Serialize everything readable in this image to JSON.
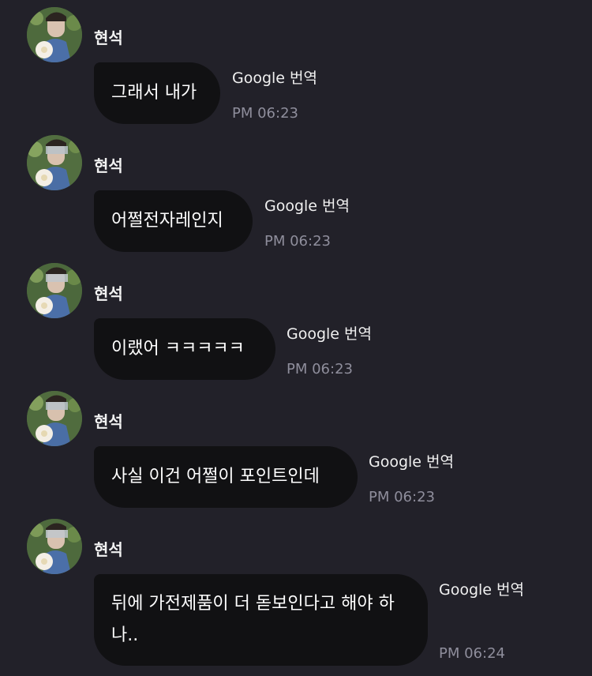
{
  "messages": [
    {
      "sender": "현석",
      "text": "그래서 내가",
      "translate": "Google 번역",
      "time": "PM 06:23"
    },
    {
      "sender": "현석",
      "text": "어쩔전자레인지",
      "translate": "Google 번역",
      "time": "PM 06:23"
    },
    {
      "sender": "현석",
      "text": "이랬어 ㅋㅋㅋㅋㅋ",
      "translate": "Google 번역",
      "time": "PM 06:23"
    },
    {
      "sender": "현석",
      "text": "사실 이건 어쩔이 포인트인데",
      "translate": "Google 번역",
      "time": "PM 06:23"
    },
    {
      "sender": "현석",
      "text": "뒤에 가전제품이 더 돋보인다고 해야 하나..",
      "translate": "Google 번역",
      "time": "PM 06:24"
    }
  ]
}
